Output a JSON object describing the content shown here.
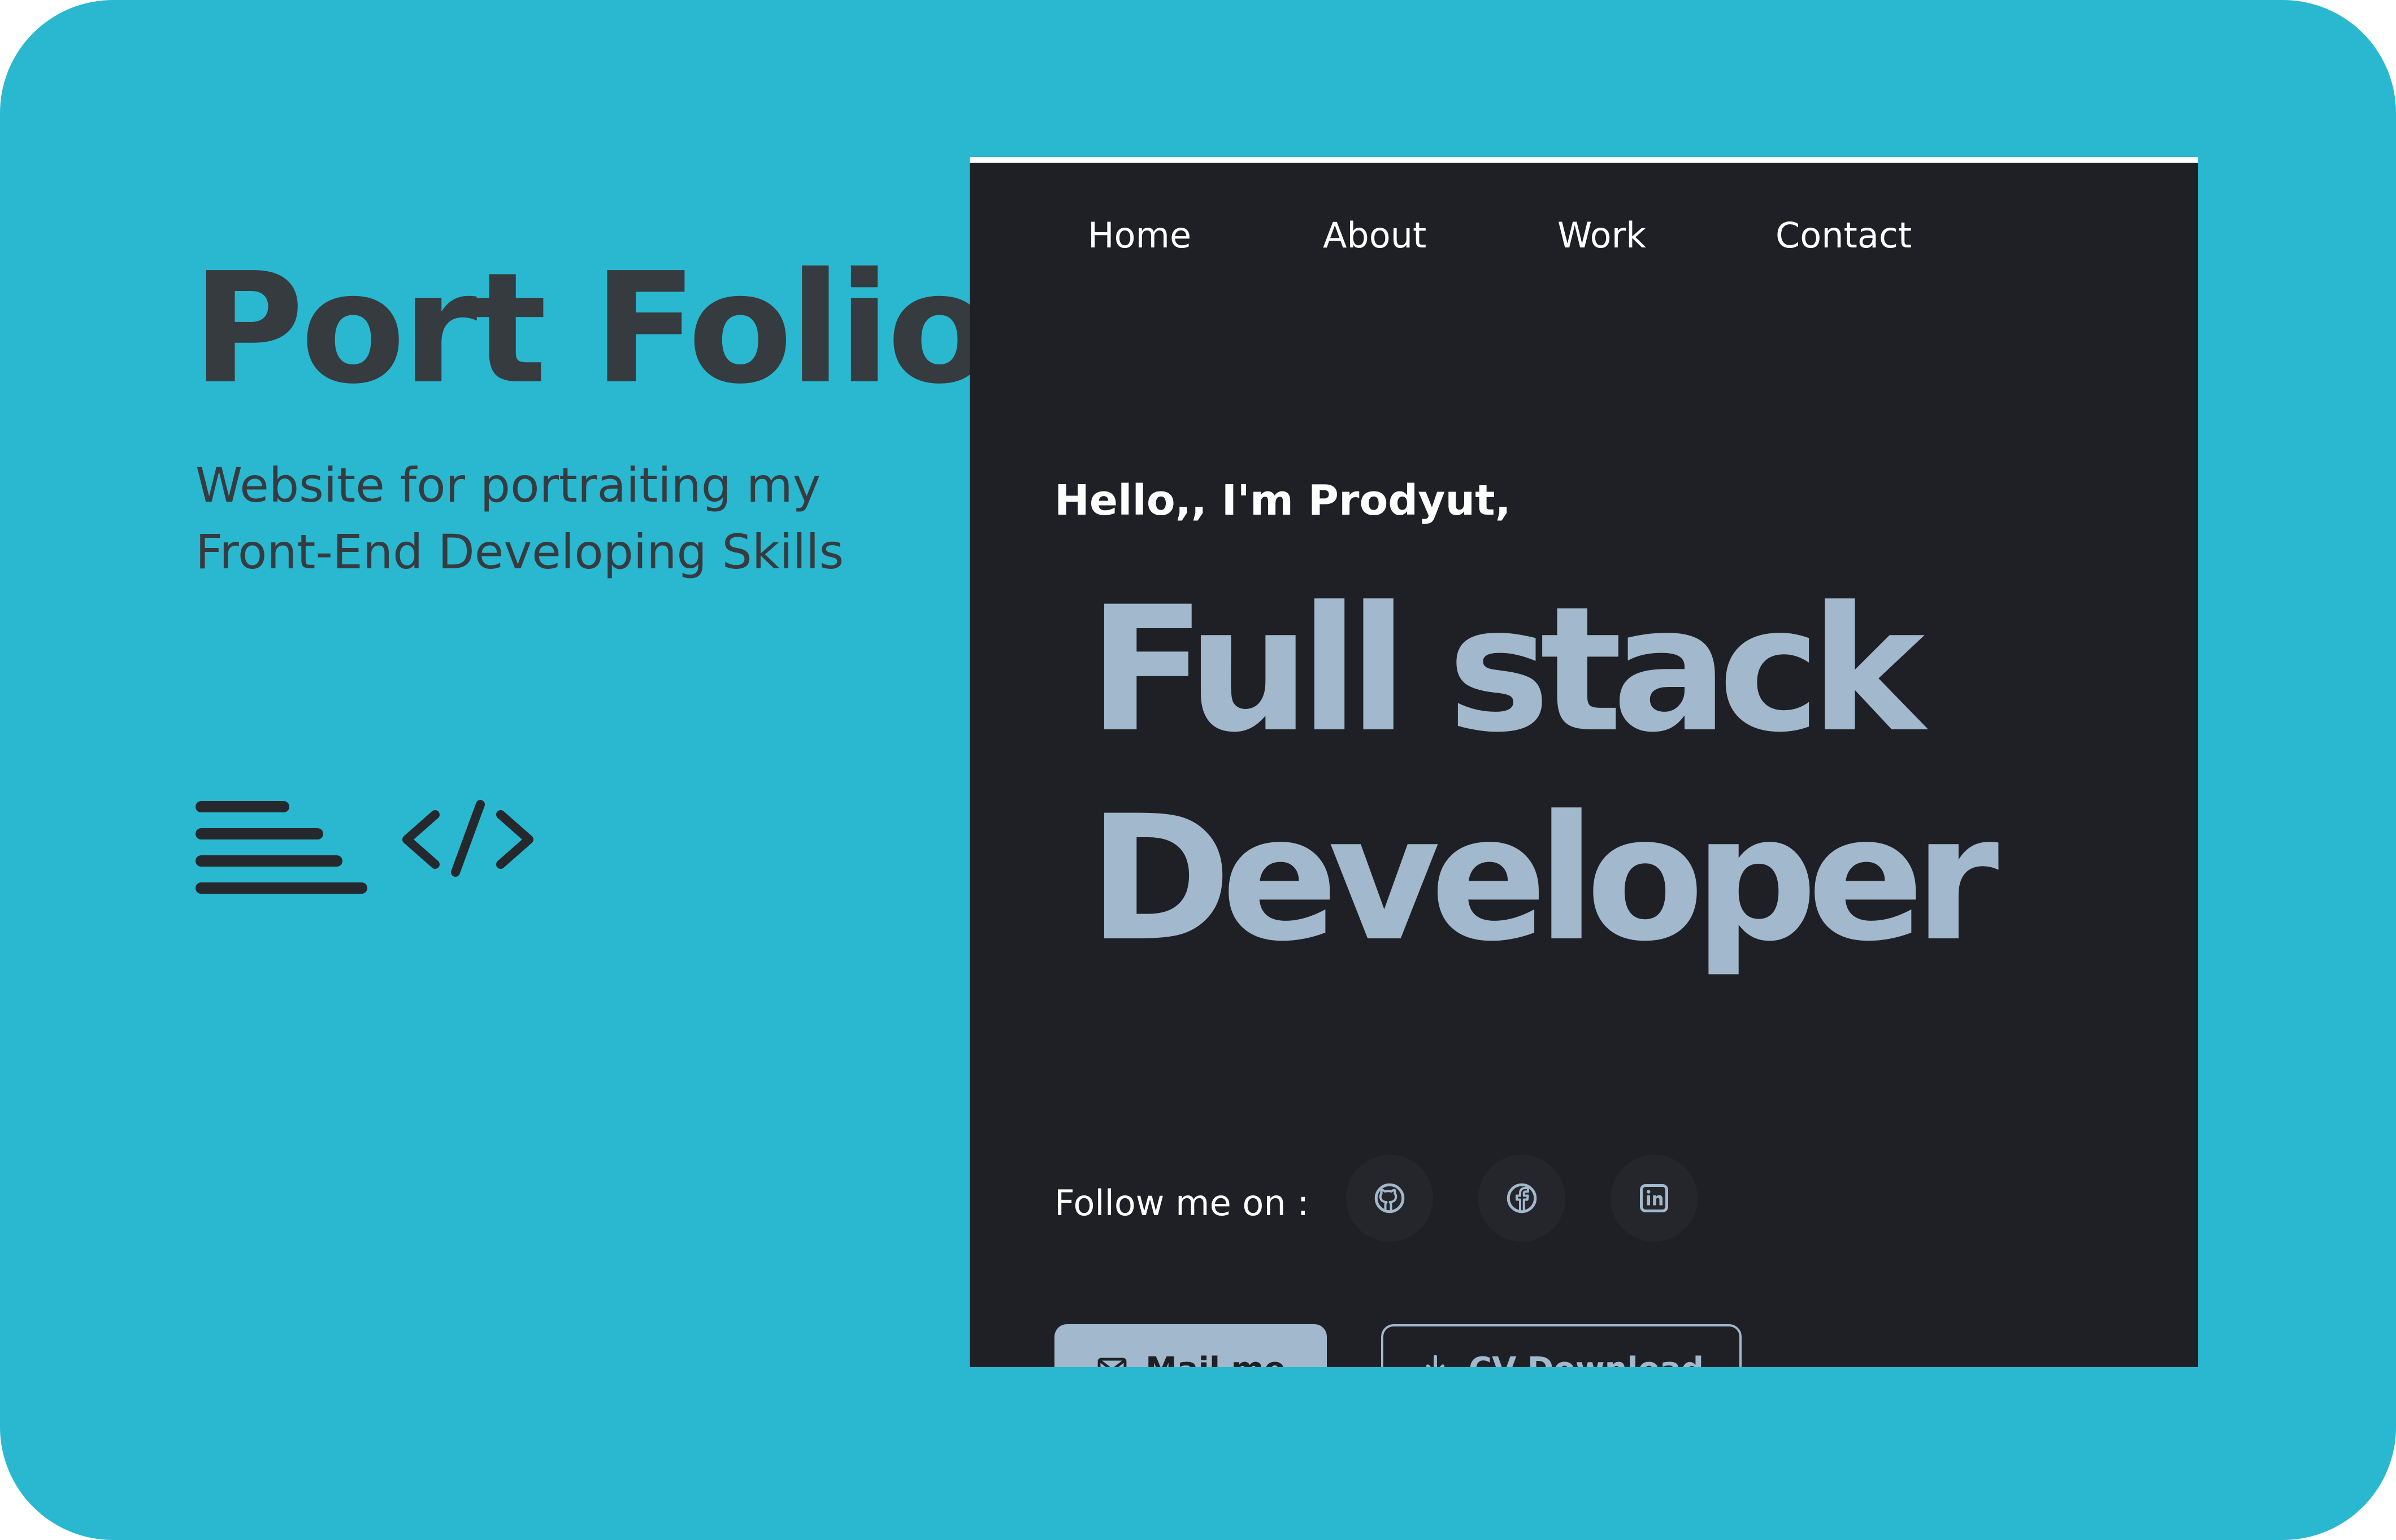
{
  "project": {
    "title": "Port Folio",
    "description": "Website for portraiting my Front-End Developing Skills"
  },
  "icons": {
    "menu_lines": "text-lines-icon",
    "code": "code-icon"
  },
  "site": {
    "nav": [
      "Home",
      "About",
      "Work",
      "Contact"
    ],
    "greeting": "Hello,, I'm Prodyut,",
    "headline_line1": "Full stack",
    "headline_line2": "Developer",
    "follow_label": "Follow me on :",
    "social": [
      "github-icon",
      "facebook-icon",
      "linkedin-icon"
    ],
    "buttons": {
      "mail": "Mail me",
      "cv": "CV Download"
    }
  },
  "colors": {
    "background": "#29b8d0",
    "title_text": "#363b40",
    "preview_background": "#1f2026",
    "accent": "#a2b8cc"
  }
}
